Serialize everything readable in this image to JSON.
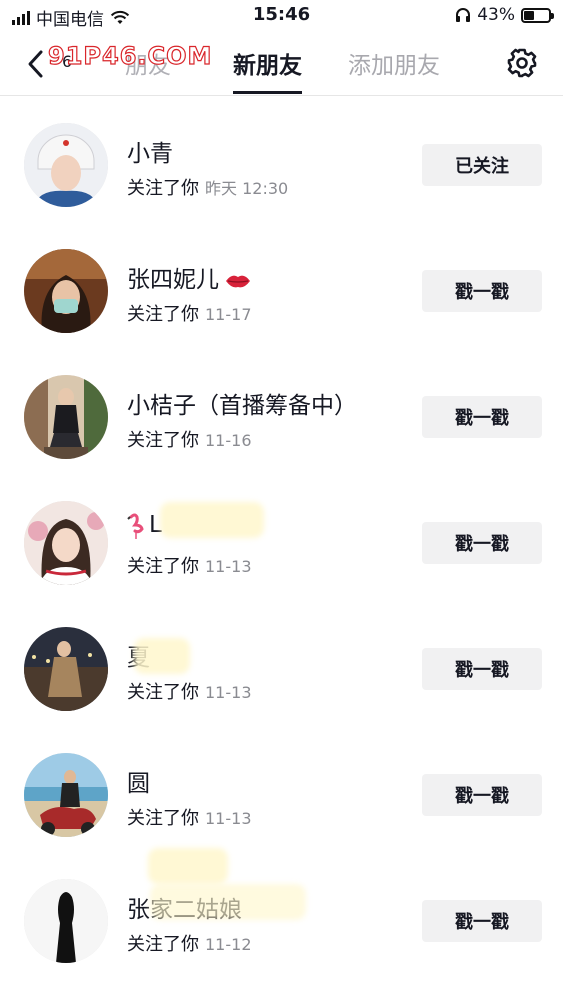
{
  "status_bar": {
    "carrier": "中国电信",
    "time": "15:46",
    "battery": "43%",
    "battery_level": 0.43
  },
  "nav": {
    "back_count": "6",
    "tabs": [
      {
        "label": "朋友"
      },
      {
        "label": "新朋友"
      },
      {
        "label": "添加朋友"
      }
    ]
  },
  "watermark": "91P46.COM",
  "rows": [
    {
      "name": "小青",
      "subtitle": "关注了你",
      "date": "昨天 12:30",
      "button": "已关注"
    },
    {
      "name": "张四妮儿",
      "subtitle": "关注了你",
      "date": "11-17",
      "button": "戳一戳"
    },
    {
      "name": "小桔子（首播筹备中）",
      "subtitle": "关注了你",
      "date": "11-16",
      "button": "戳一戳"
    },
    {
      "name": "L",
      "subtitle": "关注了你",
      "date": "11-13",
      "button": "戳一戳"
    },
    {
      "name": "夏",
      "subtitle": "关注了你",
      "date": "11-13",
      "button": "戳一戳"
    },
    {
      "name": "圆",
      "subtitle": "关注了你",
      "date": "11-13",
      "button": "戳一戳"
    },
    {
      "name": "张家二姑娘",
      "subtitle": "关注了你",
      "date": "11-12",
      "button": "戳一戳"
    }
  ],
  "icons": {
    "back": "chevron-left-icon",
    "settings": "gear-icon",
    "wifi": "wifi-icon",
    "headphones": "headphones-icon",
    "battery": "battery-icon"
  }
}
